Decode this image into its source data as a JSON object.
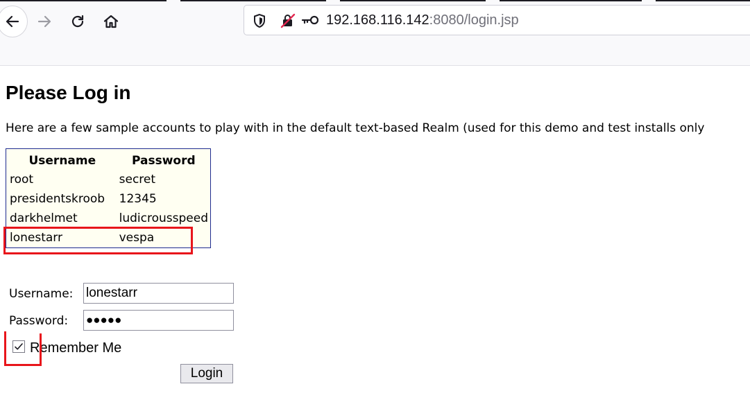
{
  "browser": {
    "url_host": "192.168.116.142",
    "url_rest": ":8080/login.jsp",
    "icons": {
      "back": "arrow-left-icon",
      "forward": "arrow-right-icon",
      "reload": "reload-icon",
      "home": "home-icon",
      "tracking": "shield-icon",
      "insecure": "insecure-lock-icon",
      "key": "key-icon"
    }
  },
  "page": {
    "title": "Please Log in",
    "intro": "Here are a few sample accounts to play with in the default text-based Realm (used for this demo and test installs only"
  },
  "accounts": {
    "headers": [
      "Username",
      "Password"
    ],
    "rows": [
      {
        "username": "root",
        "password": "secret"
      },
      {
        "username": "presidentskroob",
        "password": "12345"
      },
      {
        "username": "darkhelmet",
        "password": "ludicrousspeed"
      },
      {
        "username": "lonestarr",
        "password": "vespa"
      }
    ]
  },
  "form": {
    "username_label": "Username:",
    "username_value": "lonestarr",
    "password_label": "Password:",
    "password_masked": "●●●●●",
    "remember_label": "Remember Me",
    "remember_checked": true,
    "login_label": "Login"
  },
  "colors": {
    "highlight": "#e8151b",
    "table_border": "#1d2a8f",
    "table_bg": "#fffff2"
  }
}
